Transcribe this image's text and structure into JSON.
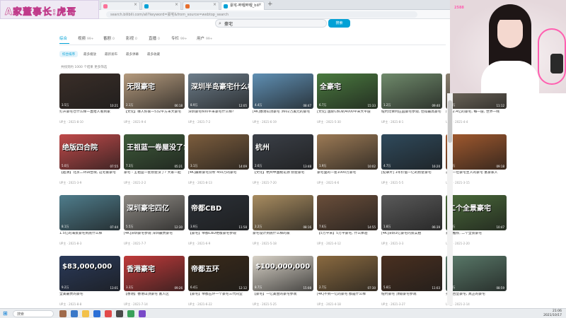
{
  "overlay": {
    "banner_text": "A家董事长:虎哥",
    "webcam_label": "2588"
  },
  "browser": {
    "tabs": [
      {
        "label": "",
        "color": "#fb7299"
      },
      {
        "label": "",
        "color": "#00a1d6"
      },
      {
        "label": "",
        "color": "#e66d2c"
      },
      {
        "label": "豪宅-哔哩哔哩_bili",
        "color": "#00a1d6"
      }
    ],
    "new_tab": "+",
    "url": "search.bilibili.com/all?keyword=豪宅&from_source=webtop_search"
  },
  "search": {
    "query": "豪宅",
    "button_label": "搜索"
  },
  "categories": [
    {
      "label": "综合",
      "count": ""
    },
    {
      "label": "视频",
      "count": "99+"
    },
    {
      "label": "番剧",
      "count": "0"
    },
    {
      "label": "影视",
      "count": "0"
    },
    {
      "label": "直播",
      "count": "0"
    },
    {
      "label": "专栏",
      "count": "99+"
    },
    {
      "label": "用户",
      "count": "99+"
    }
  ],
  "filters": [
    "综合排序",
    "最多播放",
    "最新发布",
    "最多弹幕",
    "最多收藏"
  ],
  "result_bar": "共找到约 1000 个结果   更多筛选",
  "videos": [
    {
      "thumb_text": "",
      "title": "打开豪宅仓什么样一直给人看到家",
      "meta": "UP主 · 2021-8-10",
      "stats": "3.5万",
      "dur": "10:21",
      "color": "#3a2e28"
    },
    {
      "thumb_text": "无限豪宅",
      "title": "【文化】哪人好家一532平方米大豪宅",
      "meta": "UP主 · 2021-9-4",
      "stats": "2.1万",
      "dur": "06:18",
      "color": "#b49a7d"
    },
    {
      "thumb_text": "深圳半岛豪宅什么样?",
      "title": "深圳豪宅600平米豪宅什么样?",
      "meta": "UP主 · 2021-7-2",
      "stats": "8.9万",
      "dur": "12:05",
      "color": "#6d7d8a"
    },
    {
      "thumb_text": "",
      "title": "[4K]香港山顶豪宅 3602万美元的豪宅",
      "meta": "UP主 · 2021-6-19",
      "stats": "4.4万",
      "dur": "08:47",
      "color": "#5f8fb3"
    },
    {
      "thumb_text": "全豪宅",
      "title": "[文化] 国际CBD的4000平米大平层",
      "meta": "UP主 · 2021-5-30",
      "stats": "6.7万",
      "dur": "15:33",
      "color": "#4a7a3f"
    },
    {
      "thumb_text": "",
      "title": "纽约比佛利庄园豪宅参观, 佳得最高豪宅",
      "meta": "UP主 · 2021-8-1",
      "stats": "1.2万",
      "dur": "09:40",
      "color": "#6f8a6b"
    },
    {
      "thumb_text": "",
      "title": "广州2.4亿的豪宅, 每一层, 世界一线",
      "meta": "UP主 · 2021-4-4",
      "stats": "9.8万",
      "dur": "11:12",
      "color": "#8a8070"
    },
    {
      "thumb_text": "绝版四合院",
      "title": "【超清】北京二环四合院, 这宅第豪宅",
      "meta": "UP主 · 2021-3-9",
      "stats": "5.0万",
      "dur": "07:55",
      "color": "#c04a4a"
    },
    {
      "thumb_text": "王祖蓝一卷屋没了?",
      "title": "豪宅 - 王祖蓝一套别墅没了? 大家一起",
      "meta": "UP主 · 2021-2-2",
      "stats": "7.3万",
      "dur": "05:21",
      "color": "#3e5b3a"
    },
    {
      "thumb_text": "",
      "title": "[4K]最新豪宅分析 450万的豪宅",
      "meta": "UP主 · 2021-8-13",
      "stats": "3.1万",
      "dur": "14:09",
      "color": "#7c5d3d"
    },
    {
      "thumb_text": "杭州",
      "title": "【文化】杭州中国桃花源 别墅豪宅",
      "meta": "UP主 · 2021-7-20",
      "stats": "2.6万",
      "dur": "13:48",
      "color": "#3b4048"
    },
    {
      "thumb_text": "",
      "title": "豪宅里的一套1000万豪宅",
      "meta": "UP主 · 2021-6-6",
      "stats": "1.9万",
      "dur": "10:02",
      "color": "#9c7a55"
    },
    {
      "thumb_text": "",
      "title": "[纪录片] 1年价值一亿的别墅豪宅",
      "meta": "UP主 · 2021-5-5",
      "stats": "4.7万",
      "dur": "16:20",
      "color": "#2f4a5c"
    },
    {
      "thumb_text": "",
      "title": "这是一位豪宅主人的豪宅 富豪家人",
      "meta": "UP主 · 2021-3-15",
      "stats": "6.2万",
      "dur": "09:18",
      "color": "#a35a2e"
    },
    {
      "thumb_text": "",
      "title": "1.5亿的海景豪宅到底什么样",
      "meta": "UP主 · 2021-8-3",
      "stats": "8.1万",
      "dur": "07:44",
      "color": "#4f7d8c"
    },
    {
      "thumb_text": "深圳豪宅四亿",
      "title": "[4K]深圳豪宅参观 深圳最贵豪宅",
      "meta": "UP主 · 2021-7-7",
      "stats": "5.5万",
      "dur": "12:30",
      "color": "#8e8a84"
    },
    {
      "thumb_text": "帝都CBD",
      "title": "【豪宅】帝都CBD绝版豪宅参观",
      "meta": "UP主 · 2021-6-9",
      "stats": "3.9万",
      "dur": "11:58",
      "color": "#2c3138"
    },
    {
      "thumb_text": "",
      "title": "豪宅设计到底什么样的家",
      "meta": "UP主 · 2021-5-18",
      "stats": "2.2万",
      "dur": "08:16",
      "color": "#a88c60"
    },
    {
      "thumb_text": "",
      "title": "【5万平米】5万平豪宅, 什么体验",
      "meta": "UP主 · 2021-4-12",
      "stats": "7.6万",
      "dur": "14:55",
      "color": "#6a4e3a"
    },
    {
      "thumb_text": "",
      "title": "[4K]深圳3亿豪宅内景实拍",
      "meta": "UP主 · 2021-3-3",
      "stats": "1.8万",
      "dur": "06:39",
      "color": "#5a5a5a"
    },
    {
      "thumb_text": "二个全景豪宅",
      "title": "豪宅推荐, 二个全景豪宅",
      "meta": "UP主 · 2021-2-20",
      "stats": "4.0万",
      "dur": "10:47",
      "color": "#4a6a3a"
    },
    {
      "thumb_text": "$83,000,000",
      "title": "全美最贵的豪宅",
      "meta": "UP主 · 2021-8-8",
      "stats": "9.2万",
      "dur": "13:01",
      "color": "#2a3a5a"
    },
    {
      "thumb_text": "香港豪宅",
      "title": "【香港】香港山顶豪宅 富人区",
      "meta": "UP主 · 2021-7-14",
      "stats": "3.3万",
      "dur": "09:26",
      "color": "#c03a3a"
    },
    {
      "thumb_text": "帝都五环",
      "title": "【豪宅】帝都五环一个豪宅三代同堂",
      "meta": "UP主 · 2021-6-22",
      "stats": "6.4万",
      "dur": "12:12",
      "color": "#3a2a1a"
    },
    {
      "thumb_text": "$100,000,000",
      "title": "【豪宅】一亿美金的豪宅参观",
      "meta": "UP主 · 2021-5-25",
      "stats": "8.7万",
      "dur": "15:08",
      "color": "#d9d3c8"
    },
    {
      "thumb_text": "",
      "title": "[4K]不到一亿的豪宅 都是什么样",
      "meta": "UP主 · 2021-4-18",
      "stats": "2.7万",
      "dur": "07:30",
      "color": "#8a6a40"
    },
    {
      "thumb_text": "",
      "title": "纽约豪宅 顶级豪宅参观",
      "meta": "UP主 · 2021-3-27",
      "stats": "5.8万",
      "dur": "11:03",
      "color": "#4a3020"
    },
    {
      "thumb_text": "",
      "title": "英国古堡豪宅, 真正的豪宅",
      "meta": "UP主 · 2021-2-14",
      "stats": "1.5万",
      "dur": "08:59",
      "color": "#5a7a6a"
    }
  ],
  "taskbar": {
    "search_placeholder": "搜索",
    "clock_time": "21:06",
    "clock_date": "2021/10/17"
  }
}
